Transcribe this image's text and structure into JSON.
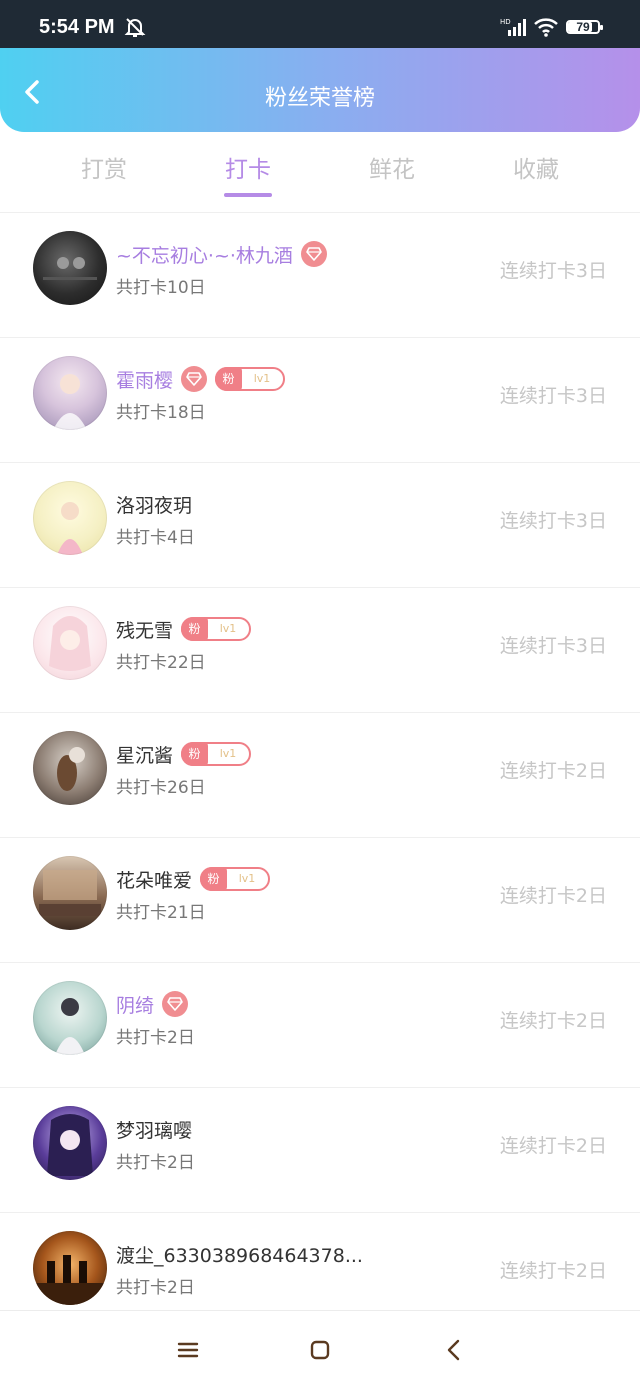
{
  "status": {
    "time": "5:54 PM",
    "battery": "79",
    "battery_level": 0.79
  },
  "header": {
    "title": "粉丝荣誉榜"
  },
  "tabs": [
    {
      "label": "打赏"
    },
    {
      "label": "打卡"
    },
    {
      "label": "鲜花"
    },
    {
      "label": "收藏"
    }
  ],
  "active_tab": "打卡",
  "fan_badge": {
    "prefix": "粉",
    "level": "lv1"
  },
  "list": [
    {
      "name": "~不忘初心·~·林九酒",
      "days": "共打卡10日",
      "streak": "连续打卡3日"
    },
    {
      "name": "霍雨樱",
      "days": "共打卡18日",
      "streak": "连续打卡3日"
    },
    {
      "name": "洛羽夜玥",
      "days": "共打卡4日",
      "streak": "连续打卡3日"
    },
    {
      "name": "残无雪",
      "days": "共打卡22日",
      "streak": "连续打卡3日"
    },
    {
      "name": "星沉酱",
      "days": "共打卡26日",
      "streak": "连续打卡2日"
    },
    {
      "name": "花朵唯爱",
      "days": "共打卡21日",
      "streak": "连续打卡2日"
    },
    {
      "name": "阴绮",
      "days": "共打卡2日",
      "streak": "连续打卡2日"
    },
    {
      "name": "梦羽璃嘤",
      "days": "共打卡2日",
      "streak": "连续打卡2日"
    },
    {
      "name": "渡尘_633038968464378...",
      "days": "共打卡2日",
      "streak": "连续打卡2日"
    }
  ],
  "colors": {
    "accent": "#b58be6",
    "header_gradient_start": "#4fd0f1",
    "header_gradient_end": "#b590ea",
    "badge": "#f07f87"
  }
}
